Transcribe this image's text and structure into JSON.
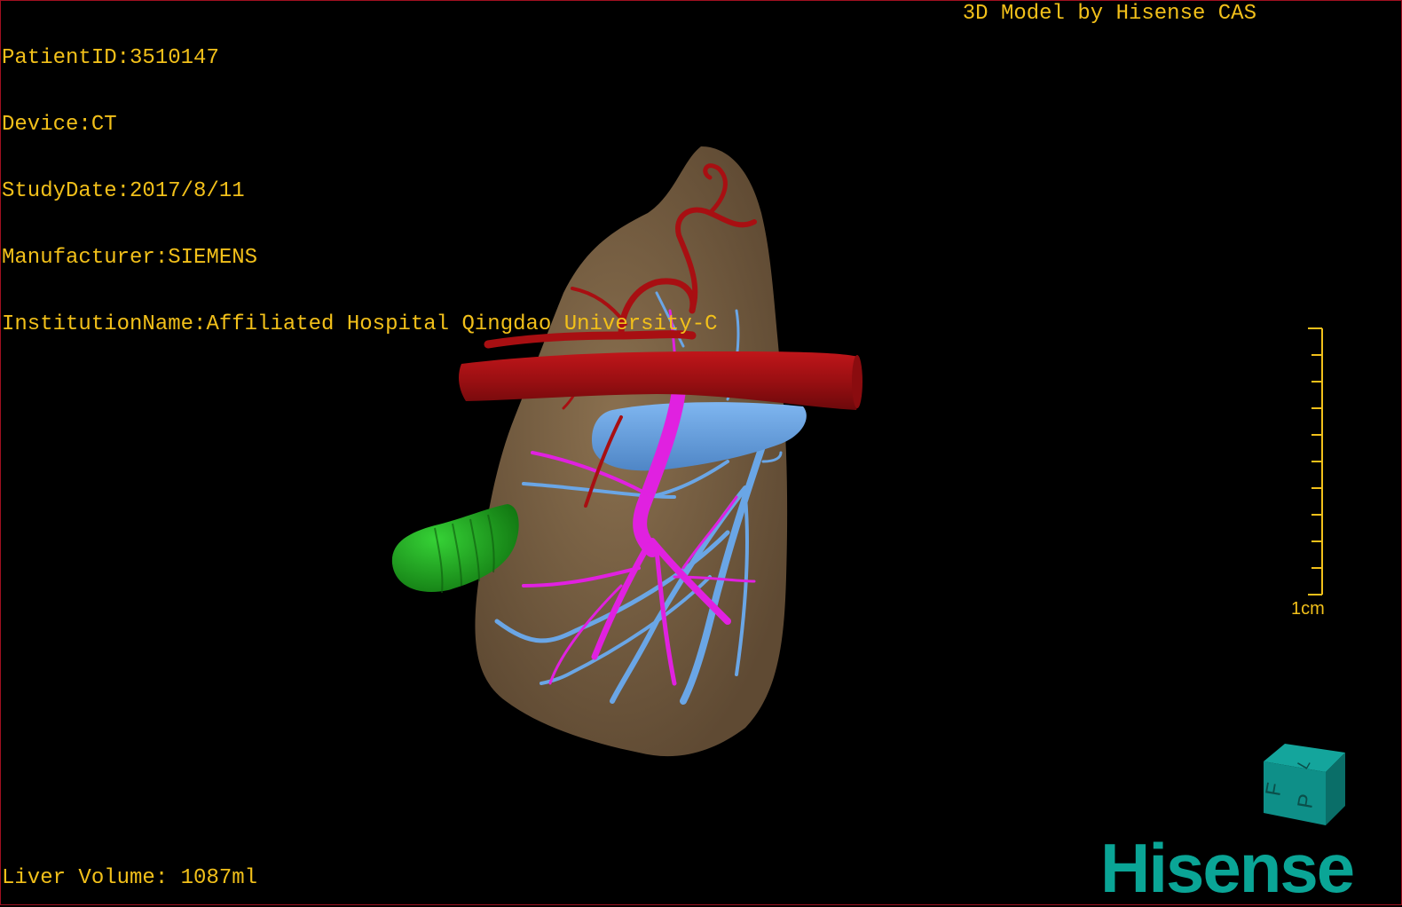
{
  "header": {
    "patient_id": "PatientID:3510147",
    "device": "Device:CT",
    "study_date": "StudyDate:2017/8/11",
    "manufacturer": "Manufacturer:SIEMENS",
    "institution": "InstitutionName:Affiliated Hospital Qingdao University-C"
  },
  "brand_text": "3D Model by Hisense CAS",
  "footer": {
    "liver_volume": "Liver Volume: 1087ml"
  },
  "scale_bar": {
    "label": "1cm",
    "tick_count": 11
  },
  "orientation_cube": {
    "faces": [
      "F",
      "L",
      "P"
    ],
    "color": "#0e8f88"
  },
  "logo_text": "Hisense",
  "colors": {
    "overlay_text": "#f2c01a",
    "liver": "#7c6446",
    "artery": "#a80f12",
    "portal_vein": "#e021e0",
    "hepatic_vein": "#6aa6e6",
    "gallbladder": "#20a820",
    "logo": "#0aa596"
  },
  "icons": [
    "orientation-cube-icon",
    "scale-bar-icon"
  ]
}
